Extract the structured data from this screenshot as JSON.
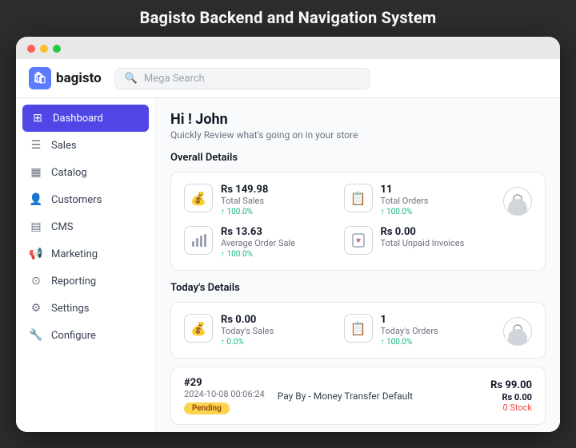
{
  "pageTitle": "Bagisto Backend and Navigation System",
  "header": {
    "logo_text": "bagisto",
    "search_placeholder": "Mega Search"
  },
  "sidebar": {
    "items": [
      {
        "id": "dashboard",
        "label": "Dashboard",
        "icon": "⊞",
        "active": true
      },
      {
        "id": "sales",
        "label": "Sales",
        "icon": "≡",
        "active": false
      },
      {
        "id": "catalog",
        "label": "Catalog",
        "icon": "⊡",
        "active": false
      },
      {
        "id": "customers",
        "label": "Customers",
        "icon": "👤",
        "active": false
      },
      {
        "id": "cms",
        "label": "CMS",
        "icon": "⊟",
        "active": false
      },
      {
        "id": "marketing",
        "label": "Marketing",
        "icon": "📢",
        "active": false
      },
      {
        "id": "reporting",
        "label": "Reporting",
        "icon": "⊙",
        "active": false
      },
      {
        "id": "settings",
        "label": "Settings",
        "icon": "⚙",
        "active": false
      },
      {
        "id": "configure",
        "label": "Configure",
        "icon": "🔧",
        "active": false
      }
    ]
  },
  "main": {
    "greeting": "Hi ! John",
    "greeting_sub": "Quickly Review what's going on in your store",
    "overall_section": "Overall Details",
    "overall_stats": [
      {
        "value": "Rs 149.98",
        "label": "Total Sales",
        "change": "100.0%",
        "icon": "💰"
      },
      {
        "value": "11",
        "label": "Total Orders",
        "change": "100.0%",
        "icon": "📋"
      },
      {
        "value": "",
        "label": "",
        "change": "",
        "icon": "avatar",
        "is_avatar": true
      }
    ],
    "overall_stats_row2": [
      {
        "value": "Rs 13.63",
        "label": "Average Order Sale",
        "change": "100.0%",
        "icon": "📊"
      },
      {
        "value": "Rs 0.00",
        "label": "Total Unpaid Invoices",
        "change": "",
        "icon": "⚠"
      }
    ],
    "today_section": "Today's Details",
    "today_stats": [
      {
        "value": "Rs 0.00",
        "label": "Today's Sales",
        "change": "0.0%",
        "icon": "💰"
      },
      {
        "value": "1",
        "label": "Today's Orders",
        "change": "100.0%",
        "icon": "📋"
      },
      {
        "is_avatar": true
      }
    ],
    "order": {
      "id": "#29",
      "date": "2024-10-08 00:06:24",
      "status": "Pending",
      "amount": "Rs 99.00",
      "payment": "Pay By - Money Transfer Default",
      "total": "Rs 0.00",
      "stock_label": "0 Stock"
    }
  }
}
